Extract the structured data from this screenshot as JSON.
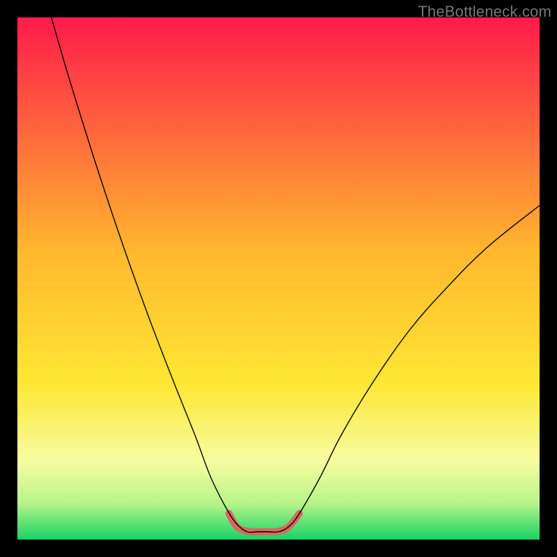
{
  "watermark": "TheBottleneck.com",
  "chart_data": {
    "type": "line",
    "title": "",
    "xlabel": "",
    "ylabel": "",
    "xlim": [
      0,
      100
    ],
    "ylim": [
      0,
      100
    ],
    "grid": false,
    "legend": false,
    "annotations": [],
    "background_gradient": {
      "stops": [
        {
          "offset": 0.0,
          "color": "#ff1a4b"
        },
        {
          "offset": 0.45,
          "color": "#ffb82e"
        },
        {
          "offset": 0.7,
          "color": "#ffe733"
        },
        {
          "offset": 0.85,
          "color": "#f7fca0"
        },
        {
          "offset": 0.93,
          "color": "#b8f58a"
        },
        {
          "offset": 1.0,
          "color": "#17d264"
        }
      ]
    },
    "series": [
      {
        "name": "bottleneck-curve",
        "style": {
          "stroke": "#000000",
          "width": 1.4
        },
        "points": [
          {
            "x": 6.5,
            "y": 100.0
          },
          {
            "x": 10.0,
            "y": 88.0
          },
          {
            "x": 15.0,
            "y": 72.0
          },
          {
            "x": 20.0,
            "y": 57.0
          },
          {
            "x": 25.0,
            "y": 43.0
          },
          {
            "x": 30.0,
            "y": 30.0
          },
          {
            "x": 34.0,
            "y": 20.0
          },
          {
            "x": 37.0,
            "y": 12.0
          },
          {
            "x": 40.0,
            "y": 6.0
          },
          {
            "x": 42.0,
            "y": 3.0
          },
          {
            "x": 44.0,
            "y": 1.5
          },
          {
            "x": 46.0,
            "y": 1.5
          },
          {
            "x": 48.0,
            "y": 1.5
          },
          {
            "x": 50.0,
            "y": 1.5
          },
          {
            "x": 52.0,
            "y": 2.5
          },
          {
            "x": 54.0,
            "y": 5.0
          },
          {
            "x": 58.0,
            "y": 12.0
          },
          {
            "x": 62.0,
            "y": 20.0
          },
          {
            "x": 68.0,
            "y": 30.0
          },
          {
            "x": 75.0,
            "y": 40.0
          },
          {
            "x": 82.0,
            "y": 48.0
          },
          {
            "x": 90.0,
            "y": 56.0
          },
          {
            "x": 100.0,
            "y": 64.0
          }
        ]
      },
      {
        "name": "tolerance-band",
        "style": {
          "stroke": "#d9675e",
          "width": 10,
          "linecap": "round"
        },
        "points": [
          {
            "x": 40.5,
            "y": 5.0
          },
          {
            "x": 42.0,
            "y": 2.5
          },
          {
            "x": 44.0,
            "y": 1.6
          },
          {
            "x": 46.0,
            "y": 1.5
          },
          {
            "x": 48.0,
            "y": 1.5
          },
          {
            "x": 50.0,
            "y": 1.6
          },
          {
            "x": 52.0,
            "y": 2.5
          },
          {
            "x": 54.0,
            "y": 5.0
          }
        ]
      }
    ]
  }
}
